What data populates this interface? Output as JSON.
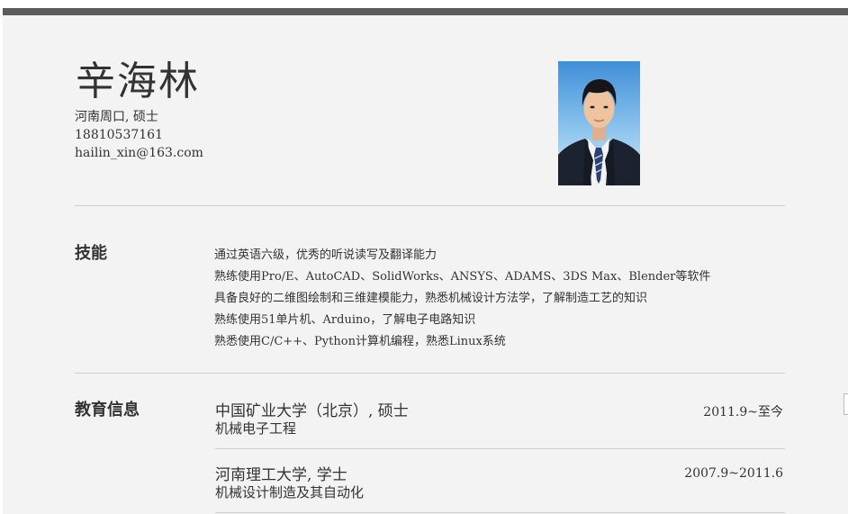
{
  "header": {
    "name": "辛海林",
    "location_degree": "河南周口, 硕士",
    "phone": "18810537161",
    "email": "hailin_xin@163.com"
  },
  "skills": {
    "title": "技能",
    "items": [
      "通过英语六级，优秀的听说读写及翻译能力",
      "熟练使用Pro/E、AutoCAD、SolidWorks、ANSYS、ADAMS、3DS Max、Blender等软件",
      "具备良好的二维图绘制和三维建模能力，熟悉机械设计方法学，了解制造工艺的知识",
      "熟练使用51单片机、Arduino，了解电子电路知识",
      "熟悉使用C/C++、Python计算机编程，熟悉Linux系统"
    ]
  },
  "education": {
    "title": "教育信息",
    "entries": [
      {
        "school": "中国矿业大学（北京）, 硕士",
        "major": "机械电子工程",
        "date": "2011.9~至今"
      },
      {
        "school": "河南理工大学, 学士",
        "major": "机械设计制造及其自动化",
        "date": "2007.9~2011.6"
      }
    ]
  },
  "colors": {
    "topbar": "#5b5b5b",
    "page_bg": "#f3f3f3",
    "divider": "#cfcfcf",
    "text": "#333333"
  }
}
